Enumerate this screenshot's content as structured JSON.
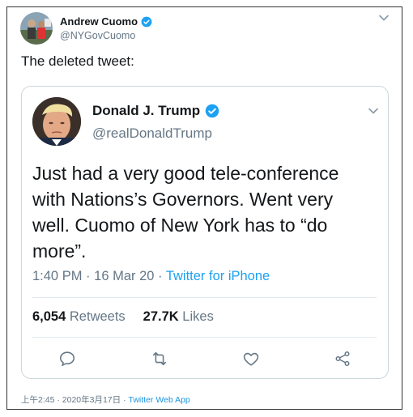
{
  "outer": {
    "name": "Andrew Cuomo",
    "handle": "@NYGovCuomo",
    "text": "The deleted tweet:"
  },
  "quoted": {
    "name": "Donald J. Trump",
    "handle": "@realDonaldTrump",
    "body": "Just had a  very good tele-conference\nwith Nations’s Governors. Went very\nwell. Cuomo of New York has to “do\nmore”.",
    "time": "1:40 PM",
    "date": "16 Mar 20",
    "source": "Twitter for iPhone",
    "retweets_count": "6,054",
    "retweets_label": "Retweets",
    "likes_count": "27.7K",
    "likes_label": "Likes"
  },
  "footer": {
    "timestamp": "上午2:45 · 2020年3月17日",
    "app": "Twitter Web App"
  },
  "colors": {
    "verified": "#1da1f2",
    "link": "#1da1f2",
    "secondary_text": "#657786",
    "border": "#ccd6dd"
  },
  "icons": [
    "verified-badge-icon",
    "chevron-down-icon",
    "reply-icon",
    "retweet-icon",
    "like-icon",
    "share-icon"
  ]
}
